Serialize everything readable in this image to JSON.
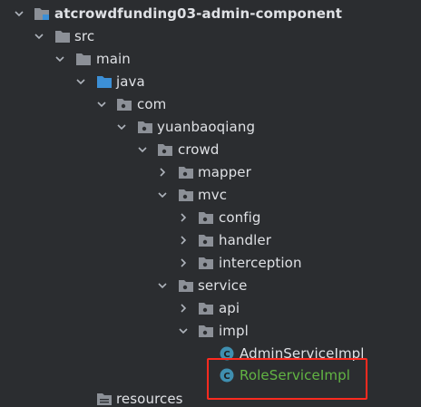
{
  "project_tree": {
    "module": {
      "label": "atcrowdfunding03-admin-component"
    },
    "src": {
      "label": "src"
    },
    "main": {
      "label": "main"
    },
    "java": {
      "label": "java"
    },
    "com": {
      "label": "com"
    },
    "yuanbaoqiang": {
      "label": "yuanbaoqiang"
    },
    "crowd": {
      "label": "crowd"
    },
    "mapper": {
      "label": "mapper"
    },
    "mvc": {
      "label": "mvc"
    },
    "config": {
      "label": "config"
    },
    "handler": {
      "label": "handler"
    },
    "interception": {
      "label": "interception"
    },
    "service": {
      "label": "service"
    },
    "api": {
      "label": "api"
    },
    "impl": {
      "label": "impl"
    },
    "admin_service_impl": {
      "label": "AdminServiceImpl"
    },
    "role_service_impl": {
      "label": "RoleServiceImpl"
    },
    "resources": {
      "label": "resources"
    }
  },
  "colors": {
    "background": "#2b2d30",
    "text": "#dfe1e5",
    "highlighted_file_text": "#62b543",
    "folder": "#8c9097",
    "source_folder": "#3c8fd6",
    "class_icon": "#3f8fb0",
    "highlight_box": "#ff2a1f"
  }
}
